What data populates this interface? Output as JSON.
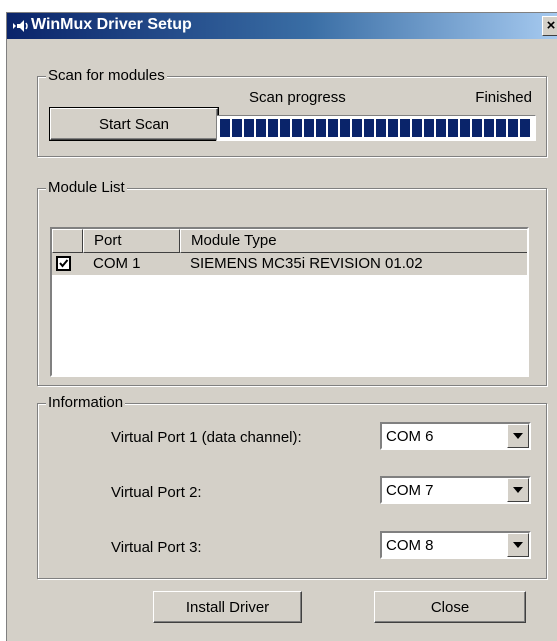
{
  "window": {
    "title": "WinMux Driver Setup",
    "close_glyph": "×",
    "app_icon": "speaker-arrow-icon"
  },
  "scan": {
    "group_label": "Scan for modules",
    "start_button": "Start Scan",
    "progress_label": "Scan progress",
    "status": "Finished",
    "progress_fraction": 1.0,
    "progress_color": "#0a246a"
  },
  "modules": {
    "group_label": "Module List",
    "columns": [
      "",
      "Port",
      "Module Type"
    ],
    "rows": [
      {
        "checked": true,
        "port": "COM 1",
        "module_type": "SIEMENS  MC35i  REVISION 01.02"
      }
    ]
  },
  "info": {
    "group_label": "Information",
    "ports": [
      {
        "label": "Virtual Port 1 (data channel):",
        "value": "COM 6"
      },
      {
        "label": "Virtual Port 2:",
        "value": "COM 7"
      },
      {
        "label": "Virtual Port 3:",
        "value": "COM 8"
      }
    ]
  },
  "footer": {
    "install_button": "Install Driver",
    "close_button": "Close"
  },
  "colors": {
    "face": "#d4d0c8",
    "title_start": "#0a246a",
    "title_end": "#a6caf0"
  }
}
